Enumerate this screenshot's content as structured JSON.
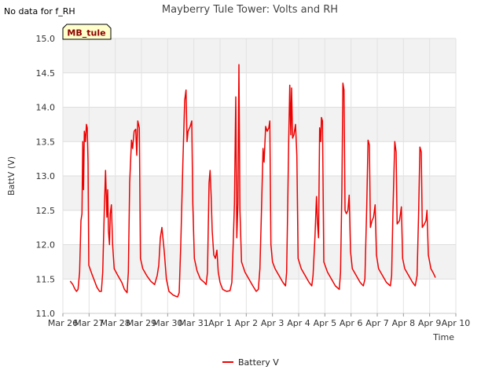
{
  "header": {
    "no_data_note": "No data for f_RH",
    "title": "Mayberry Tule Tower: Volts and RH"
  },
  "badge": {
    "label": "MB_tule",
    "background": "#ffffcc",
    "border": "#000000"
  },
  "legend": {
    "entries": [
      {
        "label": "Battery V",
        "color": "#ee0000"
      }
    ]
  },
  "chart_data": {
    "type": "line",
    "title": "Mayberry Tule Tower: Volts and RH",
    "xlabel": "Time",
    "ylabel": "BattV (V)",
    "xlim": [
      0,
      15
    ],
    "ylim": [
      11.0,
      15.0
    ],
    "x_ticks": [
      {
        "value": 0,
        "label": "Mar 26"
      },
      {
        "value": 1,
        "label": "Mar 27"
      },
      {
        "value": 2,
        "label": "Mar 28"
      },
      {
        "value": 3,
        "label": "Mar 29"
      },
      {
        "value": 4,
        "label": "Mar 30"
      },
      {
        "value": 5,
        "label": "Mar 31"
      },
      {
        "value": 6,
        "label": "Apr 1"
      },
      {
        "value": 7,
        "label": "Apr 2"
      },
      {
        "value": 8,
        "label": "Apr 3"
      },
      {
        "value": 9,
        "label": "Apr 4"
      },
      {
        "value": 10,
        "label": "Apr 5"
      },
      {
        "value": 11,
        "label": "Apr 6"
      },
      {
        "value": 12,
        "label": "Apr 7"
      },
      {
        "value": 13,
        "label": "Apr 8"
      },
      {
        "value": 14,
        "label": "Apr 9"
      },
      {
        "value": 15,
        "label": "Apr 10"
      }
    ],
    "y_ticks": [
      "11.0",
      "11.5",
      "12.0",
      "12.5",
      "13.0",
      "13.5",
      "14.0",
      "14.5",
      "15.0"
    ],
    "grid": true,
    "shaded_bands": [
      [
        11.5,
        12.0
      ],
      [
        12.5,
        13.0
      ],
      [
        13.5,
        14.0
      ],
      [
        14.5,
        15.0
      ]
    ],
    "band_color": "#f2f2f2",
    "legend_position": "bottom-center",
    "series": [
      {
        "name": "Battery V",
        "color": "#ee0000",
        "points": [
          [
            0.28,
            11.47
          ],
          [
            0.38,
            11.42
          ],
          [
            0.45,
            11.36
          ],
          [
            0.52,
            11.32
          ],
          [
            0.58,
            11.35
          ],
          [
            0.64,
            11.6
          ],
          [
            0.69,
            12.35
          ],
          [
            0.73,
            12.45
          ],
          [
            0.76,
            13.5
          ],
          [
            0.79,
            12.8
          ],
          [
            0.82,
            13.65
          ],
          [
            0.86,
            13.5
          ],
          [
            0.9,
            13.75
          ],
          [
            0.93,
            13.7
          ],
          [
            0.96,
            13.2
          ],
          [
            0.99,
            11.7
          ],
          [
            1.1,
            11.58
          ],
          [
            1.2,
            11.48
          ],
          [
            1.3,
            11.38
          ],
          [
            1.4,
            11.32
          ],
          [
            1.47,
            11.32
          ],
          [
            1.52,
            11.6
          ],
          [
            1.58,
            12.5
          ],
          [
            1.63,
            13.08
          ],
          [
            1.68,
            12.4
          ],
          [
            1.71,
            12.8
          ],
          [
            1.74,
            12.2
          ],
          [
            1.78,
            12.0
          ],
          [
            1.81,
            12.45
          ],
          [
            1.85,
            12.58
          ],
          [
            1.9,
            12.0
          ],
          [
            1.96,
            11.65
          ],
          [
            2.1,
            11.55
          ],
          [
            2.25,
            11.45
          ],
          [
            2.35,
            11.35
          ],
          [
            2.45,
            11.3
          ],
          [
            2.5,
            11.6
          ],
          [
            2.55,
            12.9
          ],
          [
            2.62,
            13.52
          ],
          [
            2.66,
            13.4
          ],
          [
            2.72,
            13.65
          ],
          [
            2.78,
            13.68
          ],
          [
            2.82,
            13.3
          ],
          [
            2.86,
            13.8
          ],
          [
            2.92,
            13.7
          ],
          [
            2.96,
            11.8
          ],
          [
            3.05,
            11.65
          ],
          [
            3.2,
            11.55
          ],
          [
            3.35,
            11.47
          ],
          [
            3.5,
            11.42
          ],
          [
            3.6,
            11.55
          ],
          [
            3.66,
            11.7
          ],
          [
            3.72,
            12.1
          ],
          [
            3.78,
            12.25
          ],
          [
            3.82,
            12.1
          ],
          [
            3.87,
            11.9
          ],
          [
            3.95,
            11.5
          ],
          [
            4.05,
            11.32
          ],
          [
            4.2,
            11.27
          ],
          [
            4.3,
            11.25
          ],
          [
            4.38,
            11.24
          ],
          [
            4.44,
            11.3
          ],
          [
            4.5,
            12.0
          ],
          [
            4.58,
            13.2
          ],
          [
            4.65,
            14.1
          ],
          [
            4.7,
            14.25
          ],
          [
            4.74,
            13.5
          ],
          [
            4.78,
            13.65
          ],
          [
            4.86,
            13.72
          ],
          [
            4.92,
            13.8
          ],
          [
            4.96,
            12.6
          ],
          [
            5.02,
            11.8
          ],
          [
            5.12,
            11.62
          ],
          [
            5.25,
            11.5
          ],
          [
            5.4,
            11.45
          ],
          [
            5.47,
            11.42
          ],
          [
            5.52,
            11.6
          ],
          [
            5.58,
            12.9
          ],
          [
            5.62,
            13.08
          ],
          [
            5.66,
            12.7
          ],
          [
            5.7,
            12.2
          ],
          [
            5.76,
            11.85
          ],
          [
            5.82,
            11.8
          ],
          [
            5.88,
            11.92
          ],
          [
            5.93,
            11.6
          ],
          [
            6.0,
            11.45
          ],
          [
            6.1,
            11.35
          ],
          [
            6.25,
            11.32
          ],
          [
            6.38,
            11.33
          ],
          [
            6.45,
            11.45
          ],
          [
            6.5,
            12.0
          ],
          [
            6.55,
            12.6
          ],
          [
            6.6,
            14.15
          ],
          [
            6.64,
            12.1
          ],
          [
            6.68,
            12.6
          ],
          [
            6.72,
            14.62
          ],
          [
            6.76,
            12.5
          ],
          [
            6.82,
            11.75
          ],
          [
            6.95,
            11.6
          ],
          [
            7.1,
            11.5
          ],
          [
            7.25,
            11.4
          ],
          [
            7.38,
            11.32
          ],
          [
            7.46,
            11.35
          ],
          [
            7.52,
            11.65
          ],
          [
            7.58,
            12.5
          ],
          [
            7.64,
            13.4
          ],
          [
            7.68,
            13.2
          ],
          [
            7.74,
            13.72
          ],
          [
            7.8,
            13.65
          ],
          [
            7.86,
            13.7
          ],
          [
            7.9,
            13.8
          ],
          [
            7.94,
            12.0
          ],
          [
            8.0,
            11.75
          ],
          [
            8.1,
            11.65
          ],
          [
            8.25,
            11.55
          ],
          [
            8.4,
            11.45
          ],
          [
            8.5,
            11.4
          ],
          [
            8.54,
            11.6
          ],
          [
            8.58,
            12.5
          ],
          [
            8.62,
            13.5
          ],
          [
            8.66,
            14.32
          ],
          [
            8.7,
            13.6
          ],
          [
            8.73,
            14.28
          ],
          [
            8.77,
            13.55
          ],
          [
            8.82,
            13.6
          ],
          [
            8.88,
            13.75
          ],
          [
            8.93,
            13.3
          ],
          [
            8.98,
            11.8
          ],
          [
            9.1,
            11.65
          ],
          [
            9.25,
            11.55
          ],
          [
            9.4,
            11.45
          ],
          [
            9.5,
            11.4
          ],
          [
            9.55,
            11.55
          ],
          [
            9.62,
            12.1
          ],
          [
            9.68,
            12.7
          ],
          [
            9.72,
            12.3
          ],
          [
            9.76,
            12.1
          ],
          [
            9.8,
            13.7
          ],
          [
            9.84,
            13.5
          ],
          [
            9.87,
            13.85
          ],
          [
            9.91,
            13.8
          ],
          [
            9.96,
            11.75
          ],
          [
            10.1,
            11.6
          ],
          [
            10.25,
            11.5
          ],
          [
            10.4,
            11.4
          ],
          [
            10.55,
            11.35
          ],
          [
            10.6,
            11.6
          ],
          [
            10.65,
            12.8
          ],
          [
            10.69,
            14.35
          ],
          [
            10.73,
            14.25
          ],
          [
            10.77,
            12.5
          ],
          [
            10.82,
            12.45
          ],
          [
            10.88,
            12.5
          ],
          [
            10.93,
            12.72
          ],
          [
            10.98,
            11.9
          ],
          [
            11.05,
            11.65
          ],
          [
            11.2,
            11.55
          ],
          [
            11.35,
            11.45
          ],
          [
            11.47,
            11.4
          ],
          [
            11.53,
            11.5
          ],
          [
            11.6,
            12.6
          ],
          [
            11.65,
            13.52
          ],
          [
            11.7,
            13.45
          ],
          [
            11.74,
            12.25
          ],
          [
            11.8,
            12.35
          ],
          [
            11.86,
            12.4
          ],
          [
            11.92,
            12.58
          ],
          [
            11.97,
            11.85
          ],
          [
            12.05,
            11.65
          ],
          [
            12.2,
            11.55
          ],
          [
            12.35,
            11.45
          ],
          [
            12.5,
            11.4
          ],
          [
            12.55,
            11.55
          ],
          [
            12.6,
            12.5
          ],
          [
            12.67,
            13.5
          ],
          [
            12.72,
            13.35
          ],
          [
            12.76,
            12.3
          ],
          [
            12.85,
            12.35
          ],
          [
            12.92,
            12.55
          ],
          [
            12.97,
            11.8
          ],
          [
            13.05,
            11.65
          ],
          [
            13.2,
            11.55
          ],
          [
            13.35,
            11.45
          ],
          [
            13.45,
            11.4
          ],
          [
            13.52,
            11.55
          ],
          [
            13.58,
            12.5
          ],
          [
            13.63,
            13.42
          ],
          [
            13.68,
            13.35
          ],
          [
            13.72,
            12.25
          ],
          [
            13.8,
            12.3
          ],
          [
            13.86,
            12.35
          ],
          [
            13.9,
            12.5
          ],
          [
            13.95,
            11.85
          ],
          [
            14.05,
            11.65
          ],
          [
            14.15,
            11.58
          ],
          [
            14.22,
            11.52
          ]
        ]
      }
    ]
  }
}
